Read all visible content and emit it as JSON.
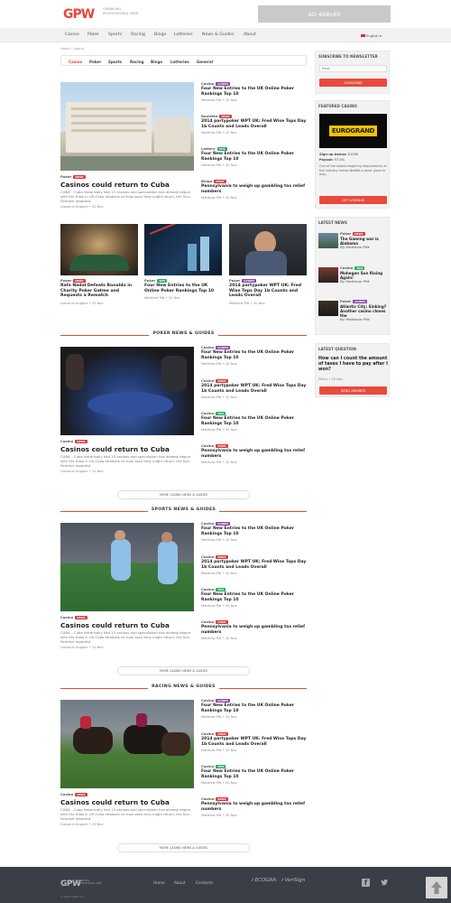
{
  "header": {
    "logo_mark": "GPW",
    "logo_text": "GAMBLING PROFESSIONAL WEB",
    "ad_label": "AD 468x60"
  },
  "nav": {
    "items": [
      "Casino",
      "Poker",
      "Sports",
      "Racing",
      "Bingo",
      "Lotteries",
      "News & Guides",
      "About"
    ],
    "language": "English"
  },
  "breadcrumb": "Home › Sports",
  "subtabs": [
    "Casino",
    "Poker",
    "Sports",
    "Racing",
    "Bingo",
    "Lotteries",
    "General"
  ],
  "top": {
    "main": {
      "category": "Poker",
      "badge": "NEWS",
      "title": "Casinos could return to Cuba",
      "excerpt": "CUBA – Cuba historically had 13 casinos and speculation has already begun with the thaw in US-Cuba relations on how soon they might return, the Sun-Sentinel reported.",
      "meta": "Giovanni Angioni • 20 Nov"
    },
    "side": [
      {
        "category": "Casino",
        "badge": "GUIDES",
        "title": "Four New Entries to the UK Online Poker Rankings Top 10",
        "meta": "Matthew Pitt • 20 Nov"
      },
      {
        "category": "Roulette",
        "badge": "NEWS",
        "title": "2014 partypoker WPT UK: Fred Wise Tops Day 1b Counts and Leads Overall",
        "meta": "Matthew Pitt • 20 Nov"
      },
      {
        "category": "Lottery",
        "badge": "TIPS",
        "title": "Four New Entries to the UK Online Poker Rankings Top 10",
        "meta": "Matthew Pitt • 20 Nov"
      },
      {
        "category": "Bingo",
        "badge": "NEWS",
        "title": "Pennsylvania to weigh up gambling tax relief numbers",
        "meta": "Matthew Pitt • 20 Nov"
      }
    ],
    "row": [
      {
        "category": "Poker",
        "badge": "NEWS",
        "title": "Rafa Nadal Defeats Ronaldo in Charity Poker Gatme and Requests a Rematch",
        "meta": "Giovanni Angioni • 20 Nov"
      },
      {
        "category": "Poker",
        "badge": "TIPS",
        "title": "Four New Entries to the UK Online Poker Rankings Top 10",
        "meta": "Matthew Pitt • 20 Nov"
      },
      {
        "category": "Poker",
        "badge": "GUIDES",
        "title": "2014 partypoker WPT UK: Fred Wise Tops Day 1b Counts and Leads Overall",
        "meta": "Matthew Pitt • 20 Nov"
      }
    ]
  },
  "sections": [
    {
      "title": "POKER NEWS & GUIDES",
      "more": "MORE CASINO NEWS & GUIDES",
      "main": {
        "category": "Casino",
        "badge": "NEWS",
        "title": "Casinos could return to Cuba",
        "excerpt": "CUBA – Cuba historically had 13 casinos and speculation has already begun with the thaw in US-Cuba relations on how soon they might return, the Sun-Sentinel reported.",
        "meta": "Giovanni Angioni • 20 Nov"
      },
      "side": [
        {
          "category": "Casino",
          "badge": "GUIDES",
          "title": "Four New Entries to the UK Online Poker Rankings Top 10",
          "meta": "Matthew Pitt • 20 Nov"
        },
        {
          "category": "Casino",
          "badge": "NEWS",
          "title": "2014 partypoker WPT UK: Fred Wise Tops Day 1b Counts and Leads Overall",
          "meta": "Matthew Pitt • 20 Nov"
        },
        {
          "category": "Casino",
          "badge": "TIPS",
          "title": "Four New Entries to the UK Online Poker Rankings Top 10",
          "meta": "Matthew Pitt • 20 Nov"
        },
        {
          "category": "Casino",
          "badge": "NEWS",
          "title": "Pennsylvania to weigh up gambling tax relief numbers",
          "meta": "Matthew Pitt • 20 Nov"
        }
      ]
    },
    {
      "title": "SPORTS NEWS & GUIDES",
      "more": "MORE CASINO NEWS & GUIDES",
      "main": {
        "category": "Casino",
        "badge": "NEWS",
        "title": "Casinos could return to Cuba",
        "excerpt": "CUBA – Cuba historically had 13 casinos and speculation has already begun with the thaw in US-Cuba relations on how soon they might return, the Sun-Sentinel reported.",
        "meta": "Giovanni Angioni • 20 Nov"
      },
      "side": [
        {
          "category": "Casino",
          "badge": "GUIDES",
          "title": "Four New Entries to the UK Online Poker Rankings Top 10",
          "meta": "Matthew Pitt • 20 Nov"
        },
        {
          "category": "Casino",
          "badge": "NEWS",
          "title": "2014 partypoker WPT UK: Fred Wise Tops Day 1b Counts and Leads Overall",
          "meta": "Matthew Pitt • 20 Nov"
        },
        {
          "category": "Casino",
          "badge": "TIPS",
          "title": "Four New Entries to the UK Online Poker Rankings Top 10",
          "meta": "Matthew Pitt • 20 Nov"
        },
        {
          "category": "Casino",
          "badge": "NEWS",
          "title": "Pennsylvania to weigh up gambling tax relief numbers",
          "meta": "Matthew Pitt • 20 Nov"
        }
      ]
    },
    {
      "title": "RACING NEWS & GUIDES",
      "more": "MORE CASINO NEWS & GUIDES",
      "main": {
        "category": "Casino",
        "badge": "NEWS",
        "title": "Casinos could return to Cuba",
        "excerpt": "CUBA – Cuba historically had 13 casinos and speculation has already begun with the thaw in US-Cuba relations on how soon they might return, the Sun-Sentinel reported.",
        "meta": "Giovanni Angioni • 20 Nov"
      },
      "side": [
        {
          "category": "Casino",
          "badge": "GUIDES",
          "title": "Four New Entries to the UK Online Poker Rankings Top 10",
          "meta": "Matthew Pitt • 20 Nov"
        },
        {
          "category": "Casino",
          "badge": "NEWS",
          "title": "2014 partypoker WPT UK: Fred Wise Tops Day 1b Counts and Leads Overall",
          "meta": "Matthew Pitt • 20 Nov"
        },
        {
          "category": "Casino",
          "badge": "TIPS",
          "title": "Four New Entries to the UK Online Poker Rankings Top 10",
          "meta": "Matthew Pitt • 20 Nov"
        },
        {
          "category": "Casino",
          "badge": "NEWS",
          "title": "Pennsylvania to weigh up gambling tax relief numbers",
          "meta": "Matthew Pitt • 20 Nov"
        }
      ]
    }
  ],
  "sidebar": {
    "newsletter": {
      "title": "SUBSCRIBE TO NEWSLETTER",
      "placeholder": "Email",
      "button": "SUBSCRIBE"
    },
    "featured": {
      "title": "FEATURED CASINO",
      "logo": "EUROGRAND",
      "signup_label": "Sign-up bonus:",
      "signup_value": "$1000",
      "payout_label": "Payout:",
      "payout_value": "97.2%",
      "desc": "One of the lowest wagering requirements in the industry makes NetBet a great place to play.",
      "button": "GET A BONUS"
    },
    "latest_news": {
      "title": "LATEST NEWS",
      "items": [
        {
          "category": "Poker",
          "badge": "NEWS",
          "title": "The Gaming war is Alabama",
          "meta": "By Matthew Pitt"
        },
        {
          "category": "Casino",
          "badge": "TIPS",
          "title": "Mohegan Sun Rising Again!",
          "meta": "By Matthew Pitt"
        },
        {
          "category": "Poker",
          "badge": "GUIDES",
          "title": "Atlantic City: Sinking? Another casino closes the",
          "meta": "By Matthew Pitt"
        }
      ]
    },
    "latest_question": {
      "title": "LATEST QUESTION",
      "question": "How can I count the amount of taxes I have to pay after I won?",
      "meta": "Piters • 20 Nov",
      "button": "SEND ANSWER"
    }
  },
  "footer": {
    "logo": "GPW",
    "logo_sub": "GAMBLING PROFESSIONAL WEB",
    "links": [
      "Home",
      "About",
      "Contacts"
    ],
    "copyright": "© 2014 GPW.com",
    "badges": [
      "ECOGRA",
      "VeriSign"
    ]
  },
  "colors": {
    "accent": "#e84a3c",
    "news": "#d9383a",
    "guides": "#8e44ad",
    "tips": "#27ae60",
    "footer": "#3a3f47"
  }
}
